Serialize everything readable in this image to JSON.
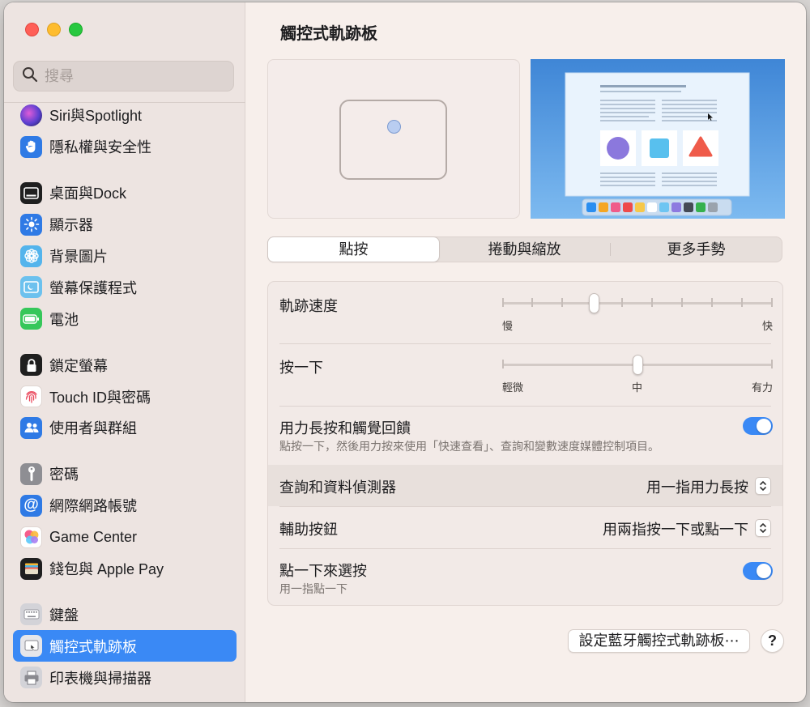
{
  "window": {
    "title": "觸控式軌跡板"
  },
  "search": {
    "placeholder": "搜尋"
  },
  "sidebar": {
    "groups": [
      [
        {
          "label": "Siri與Spotlight",
          "icon": "siri-icon"
        },
        {
          "label": "隱私權與安全性",
          "icon": "privacy-hand-icon"
        }
      ],
      [
        {
          "label": "桌面與Dock",
          "icon": "desktop-dock-icon"
        },
        {
          "label": "顯示器",
          "icon": "displays-icon"
        },
        {
          "label": "背景圖片",
          "icon": "wallpaper-icon"
        },
        {
          "label": "螢幕保護程式",
          "icon": "screensaver-icon"
        },
        {
          "label": "電池",
          "icon": "battery-icon"
        }
      ],
      [
        {
          "label": "鎖定螢幕",
          "icon": "lock-screen-icon"
        },
        {
          "label": "Touch ID與密碼",
          "icon": "touch-id-icon"
        },
        {
          "label": "使用者與群組",
          "icon": "users-groups-icon"
        }
      ],
      [
        {
          "label": "密碼",
          "icon": "passwords-key-icon"
        },
        {
          "label": "網際網路帳號",
          "icon": "internet-accounts-icon"
        },
        {
          "label": "Game Center",
          "icon": "game-center-icon"
        },
        {
          "label": "錢包與 Apple Pay",
          "icon": "wallet-icon"
        }
      ],
      [
        {
          "label": "鍵盤",
          "icon": "keyboard-icon"
        },
        {
          "label": "觸控式軌跡板",
          "icon": "trackpad-icon",
          "active": true
        },
        {
          "label": "印表機與掃描器",
          "icon": "printer-icon"
        }
      ]
    ]
  },
  "tabs": {
    "items": [
      "點按",
      "捲動與縮放",
      "更多手勢"
    ],
    "selected": "點按"
  },
  "settings": {
    "tracking": {
      "label": "軌跡速度",
      "min_label": "慢",
      "max_label": "快",
      "level": 0.34
    },
    "click": {
      "label": "按一下",
      "low_label": "輕微",
      "mid_label": "中",
      "high_label": "有力",
      "level": 0.5
    },
    "force_click": {
      "label": "用力長按和觸覺回饋",
      "description": "點按一下，然後用力按來使用「快速查看」、查詢和變數速度媒體控制項目。",
      "enabled": true
    },
    "lookup": {
      "label": "查詢和資料偵測器",
      "value": "用一指用力長按"
    },
    "secondary_click": {
      "label": "輔助按鈕",
      "value": "用兩指按一下或點一下"
    },
    "tap_to_click": {
      "label": "點一下來選按",
      "description": "用一指點一下",
      "enabled": true
    }
  },
  "footer": {
    "bluetooth_button": "設定藍牙觸控式軌跡板⋯",
    "help_button": "?"
  },
  "colors": {
    "accent": "#3a89f5",
    "sidebar_bg": "#ede4e1",
    "main_bg": "#f7efeb"
  }
}
